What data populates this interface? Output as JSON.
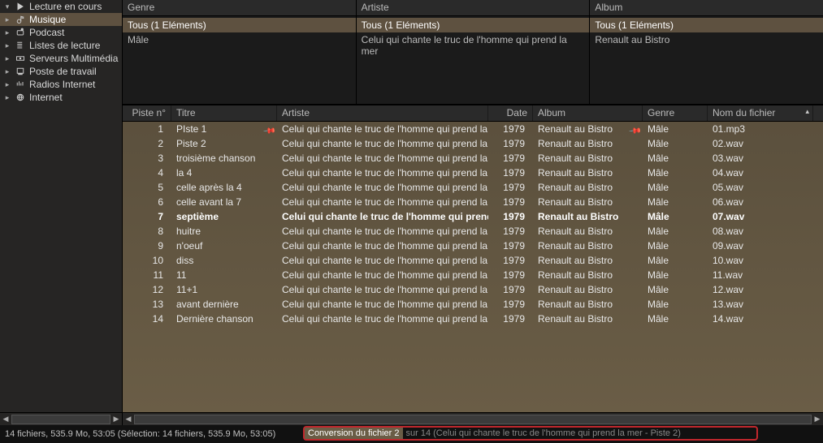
{
  "sidebar": {
    "items": [
      {
        "label": "Lecture en cours",
        "expanded": true
      },
      {
        "label": "Musique"
      },
      {
        "label": "Podcast"
      },
      {
        "label": "Listes de lecture"
      },
      {
        "label": "Serveurs Multimédia"
      },
      {
        "label": "Poste de travail"
      },
      {
        "label": "Radios Internet"
      },
      {
        "label": "Internet"
      }
    ]
  },
  "filters": {
    "genre": {
      "header": "Genre",
      "rows": [
        "Tous (1 Eléments)",
        "Mâle"
      ],
      "selected": 0
    },
    "artiste": {
      "header": "Artiste",
      "rows": [
        "Tous (1 Eléments)",
        "Celui qui chante le truc de l'homme qui prend la mer"
      ],
      "selected": 0
    },
    "album": {
      "header": "Album",
      "rows": [
        "Tous (1 Eléments)",
        "Renault au Bistro"
      ],
      "selected": 0
    }
  },
  "columns": {
    "piste": "Piste n°",
    "titre": "Titre",
    "artiste": "Artiste",
    "date": "Date",
    "album": "Album",
    "genre": "Genre",
    "fichier": "Nom du fichier"
  },
  "tracks": [
    {
      "n": "1",
      "titre": "PIste 1",
      "artiste": "Celui qui chante le truc de l'homme qui prend la mer",
      "date": "1979",
      "album": "Renault au Bistro",
      "genre": "Mâle",
      "file": "01.mp3",
      "pin": true
    },
    {
      "n": "2",
      "titre": "Piste 2",
      "artiste": "Celui qui chante le truc de l'homme qui prend la mer",
      "date": "1979",
      "album": "Renault au Bistro",
      "genre": "Mâle",
      "file": "02.wav"
    },
    {
      "n": "3",
      "titre": "troisième chanson",
      "artiste": "Celui qui chante le truc de l'homme qui prend la mer",
      "date": "1979",
      "album": "Renault au Bistro",
      "genre": "Mâle",
      "file": "03.wav"
    },
    {
      "n": "4",
      "titre": "la 4",
      "artiste": "Celui qui chante le truc de l'homme qui prend la mer",
      "date": "1979",
      "album": "Renault au Bistro",
      "genre": "Mâle",
      "file": "04.wav"
    },
    {
      "n": "5",
      "titre": "celle après la 4",
      "artiste": "Celui qui chante le truc de l'homme qui prend la mer",
      "date": "1979",
      "album": "Renault au Bistro",
      "genre": "Mâle",
      "file": "05.wav"
    },
    {
      "n": "6",
      "titre": "celle avant la 7",
      "artiste": "Celui qui chante le truc de l'homme qui prend la mer",
      "date": "1979",
      "album": "Renault au Bistro",
      "genre": "Mâle",
      "file": "06.wav"
    },
    {
      "n": "7",
      "titre": "septième",
      "artiste": "Celui qui chante le truc de l'homme qui prend l…",
      "date": "1979",
      "album": "Renault au Bistro",
      "genre": "Mâle",
      "file": "07.wav",
      "bold": true
    },
    {
      "n": "8",
      "titre": "huitre",
      "artiste": "Celui qui chante le truc de l'homme qui prend la mer",
      "date": "1979",
      "album": "Renault au Bistro",
      "genre": "Mâle",
      "file": "08.wav"
    },
    {
      "n": "9",
      "titre": "n'oeuf",
      "artiste": "Celui qui chante le truc de l'homme qui prend la mer",
      "date": "1979",
      "album": "Renault au Bistro",
      "genre": "Mâle",
      "file": "09.wav"
    },
    {
      "n": "10",
      "titre": "diss",
      "artiste": "Celui qui chante le truc de l'homme qui prend la mer",
      "date": "1979",
      "album": "Renault au Bistro",
      "genre": "Mâle",
      "file": "10.wav"
    },
    {
      "n": "11",
      "titre": "11",
      "artiste": "Celui qui chante le truc de l'homme qui prend la mer",
      "date": "1979",
      "album": "Renault au Bistro",
      "genre": "Mâle",
      "file": "11.wav"
    },
    {
      "n": "12",
      "titre": "11+1",
      "artiste": "Celui qui chante le truc de l'homme qui prend la mer",
      "date": "1979",
      "album": "Renault au Bistro",
      "genre": "Mâle",
      "file": "12.wav"
    },
    {
      "n": "13",
      "titre": "avant dernière",
      "artiste": "Celui qui chante le truc de l'homme qui prend la mer",
      "date": "1979",
      "album": "Renault au Bistro",
      "genre": "Mâle",
      "file": "13.wav"
    },
    {
      "n": "14",
      "titre": "Dernière chanson",
      "artiste": "Celui qui chante le truc de l'homme qui prend la mer",
      "date": "1979",
      "album": "Renault au Bistro",
      "genre": "Mâle",
      "file": "14.wav"
    }
  ],
  "status": {
    "text": "14 fichiers, 535.9 Mo, 53:05 (Sélection: 14 fichiers, 535.9 Mo, 53:05)",
    "conversion_label": "Conversion du fichier 2",
    "conversion_rest": "sur 14 (Celui qui chante le truc de l'homme qui prend la mer - Piste 2)"
  }
}
